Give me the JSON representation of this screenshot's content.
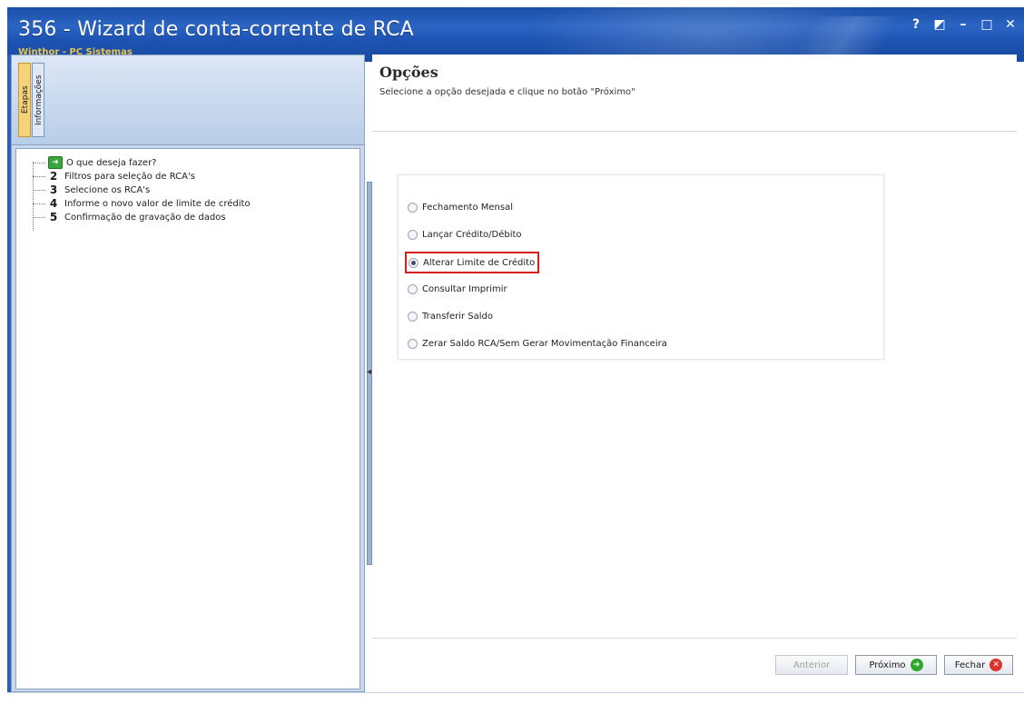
{
  "window": {
    "title": "356 - Wizard de conta-corrente de RCA",
    "subtitle": "Winthor - PC Sistemas",
    "controls": {
      "help": "?",
      "restore_alt": "◩",
      "minimize": "–",
      "maximize": "□",
      "close": "✕"
    }
  },
  "left_panel": {
    "tabs": [
      "Etapas",
      "Informações"
    ],
    "active_tab": "Etapas",
    "steps": [
      {
        "number": "",
        "icon": "green-arrow-icon",
        "label": "O que deseja fazer?"
      },
      {
        "number": "2",
        "label": "Filtros para seleção de RCA's"
      },
      {
        "number": "3",
        "label": "Selecione os RCA's"
      },
      {
        "number": "4",
        "label": "Informe o novo valor de limite de crédito"
      },
      {
        "number": "5",
        "label": "Confirmação de gravação de dados"
      }
    ]
  },
  "main": {
    "title": "Opções",
    "description": "Selecione a opção desejada e clique no botão \"Próximo\"",
    "options": [
      {
        "label": "Fechamento Mensal",
        "checked": false
      },
      {
        "label": "Lançar Crédito/Débito",
        "checked": false
      },
      {
        "label": "Alterar Limite de Crédito",
        "checked": true,
        "highlighted": true
      },
      {
        "label": "Consultar Imprimir",
        "checked": false
      },
      {
        "label": "Transferir Saldo",
        "checked": false
      },
      {
        "label": "Zerar Saldo RCA/Sem Gerar Movimentação Financeira",
        "checked": false
      }
    ]
  },
  "buttons": {
    "previous": "Anterior",
    "next": "Próximo",
    "close": "Fechar"
  },
  "colors": {
    "titlebar": "#1f56b0",
    "highlight_border": "#d91e1e",
    "accent_green": "#2da82d",
    "accent_red": "#d9332a"
  }
}
